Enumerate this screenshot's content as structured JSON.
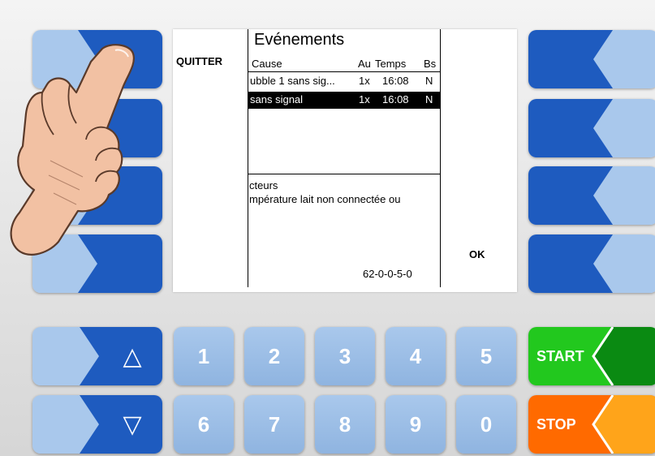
{
  "display": {
    "title": "Evénements",
    "quit_label": "QUITTER",
    "ok_label": "OK",
    "columns": {
      "cause": "Cause",
      "count": "Au",
      "time": "Temps",
      "bs": "Bs"
    },
    "rows": [
      {
        "cause": "ubble 1 sans sig...",
        "count": "1x",
        "time": "16:08",
        "bs": "N",
        "selected": false
      },
      {
        "cause": "sans signal",
        "count": "1x",
        "time": "16:08",
        "bs": "N",
        "selected": true
      }
    ],
    "detail_line1": "cteurs",
    "detail_line2": "mpérature lait non connectée ou",
    "code": "62-0-0-5-0"
  },
  "keypad": {
    "up_icon": "up-triangle-icon",
    "down_icon": "down-triangle-icon",
    "up_glyph": "△",
    "down_glyph": "▽",
    "numbers_row1": [
      "1",
      "2",
      "3",
      "4",
      "5"
    ],
    "numbers_row2": [
      "6",
      "7",
      "8",
      "9",
      "0"
    ],
    "start_label": "START",
    "stop_label": "STOP"
  },
  "colors": {
    "softkey_dark": "#1e5bbf",
    "softkey_light": "#a9c8ec",
    "start_green": "#22c81e",
    "stop_orange": "#ff6a00",
    "stop_light": "#ffa41a"
  }
}
